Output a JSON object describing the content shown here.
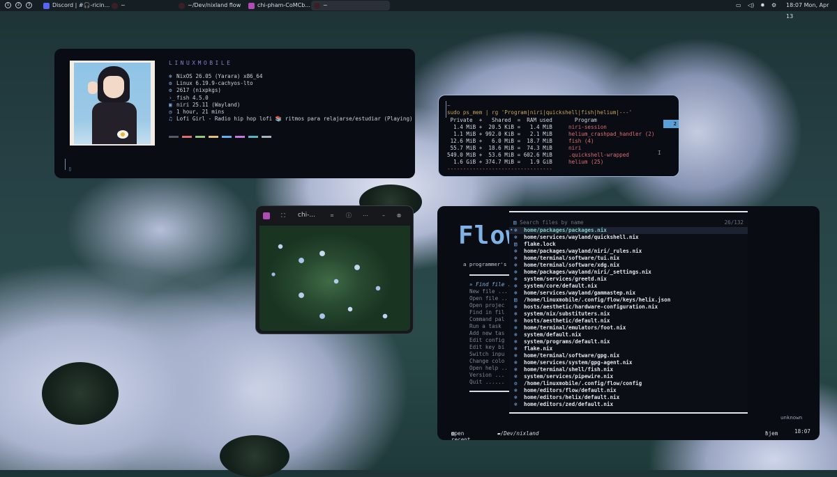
{
  "topbar": {
    "workspaces": [
      "1",
      "2",
      "3"
    ],
    "tasks": [
      {
        "label": "Discord | #🎧-ricin...",
        "color": "#5865f2"
      },
      {
        "label": "~",
        "color": "#3a1f24"
      },
      {
        "label": "~/Dev/nixland flow",
        "color": "#3a1f24"
      },
      {
        "label": "chi-pham-CoMCb...",
        "color": "#b04cb6"
      },
      {
        "label": "~",
        "color": "#3a1f24"
      }
    ],
    "clock": "18:07 Mon, Apr 13",
    "tray_icons": [
      "camera-icon",
      "volume-icon",
      "brightness-icon",
      "settings-icon"
    ]
  },
  "fetch": {
    "title": "LINUXMOBILE",
    "rows": [
      {
        "icon": "❄",
        "text": "NixOS 26.05 (Yarara) x86_64"
      },
      {
        "icon": "⚙",
        "text": "Linux 6.19.9-cachyos-lto"
      },
      {
        "icon": "⚙",
        "text": "2617 (nixpkgs)"
      },
      {
        "icon": "›_",
        "text": "fish 4.5.0"
      },
      {
        "icon": "▣",
        "text": "niri 25.11 (Wayland)"
      },
      {
        "icon": "◷",
        "text": "1 hour, 21 mins"
      },
      {
        "icon": "♫",
        "text": "Lofi Girl - Radio hip hop lofi 📚 ritmos para relajarse/estudiar (Playing)"
      }
    ],
    "swatches": [
      "#555a66",
      "#e06c75",
      "#98c379",
      "#e5c07b",
      "#61afef",
      "#c678dd",
      "#56b6c2",
      "#abb2bf"
    ],
    "cursor": "▯"
  },
  "psmem": {
    "tilde": "~",
    "command": "sudo ps_mem | rg 'Program|niri|quickshell|fish|helium|---'",
    "header": " Private  +   Shared  =  RAM used       Program",
    "rows": [
      {
        "mem": "  1.4 MiB +  20.5 KiB =   1.4 MiB",
        "prog": "niri-session",
        "color": "#e06c75"
      },
      {
        "mem": "  1.1 MiB + 992.0 KiB =   2.1 MiB",
        "prog": "helium_crashpad_handler (2)",
        "color": "#e06c75"
      },
      {
        "mem": " 12.6 MiB +   6.0 MiB =  18.7 MiB",
        "prog": "fish (4)",
        "color": "#e06c75"
      },
      {
        "mem": " 55.7 MiB +  18.6 MiB =  74.3 MiB",
        "prog": "niri",
        "color": "#e06c75"
      },
      {
        "mem": "549.0 MiB +  53.6 MiB = 602.6 MiB",
        "prog": ".quickshell-wrapped",
        "color": "#e06c75"
      },
      {
        "mem": "  1.6 GiB + 374.7 MiB =   1.9 GiB",
        "prog": "helium (25)",
        "color": "#e06c75"
      }
    ],
    "divider": "---------------------------------",
    "badge": "2"
  },
  "viewer": {
    "title": "chi-...",
    "icons": [
      "app-icon",
      "fullscreen-icon",
      "crop-icon",
      "info-icon",
      "more-icon",
      "minimize-icon",
      "close-icon"
    ]
  },
  "flow": {
    "banner": "Flow",
    "tagline": "a programmer's",
    "menu": [
      "» Find file ..",
      "  New file ...",
      "  Open file ..",
      "  Open projec",
      "  Find in fil",
      "  Command pal",
      "  Run a task",
      "  Add new tas",
      "  Edit config",
      "  Edit key bi",
      "  Switch inpu",
      "  Change colo",
      "  Open help ..",
      "  Version ...",
      "  Quit ......"
    ],
    "search_placeholder": "Search files by name",
    "count": "26/132",
    "files": [
      {
        "path": "home/packages/packages.nix",
        "icon": "❄",
        "current": true
      },
      {
        "path": "home/services/wayland/quickshell.nix",
        "icon": "❄"
      },
      {
        "path": "flake.lock",
        "icon": "▤"
      },
      {
        "path": "home/packages/wayland/niri/_rules.nix",
        "icon": "❄"
      },
      {
        "path": "home/terminal/software/tui.nix",
        "icon": "❄"
      },
      {
        "path": "home/terminal/software/xdg.nix",
        "icon": "❄"
      },
      {
        "path": "home/packages/wayland/niri/_settings.nix",
        "icon": "❄"
      },
      {
        "path": "system/services/greetd.nix",
        "icon": "❄"
      },
      {
        "path": "system/core/default.nix",
        "icon": "❄"
      },
      {
        "path": "home/services/wayland/gammastep.nix",
        "icon": "❄"
      },
      {
        "path": "/home/linuxmobile/.config/flow/keys/helix.json",
        "icon": "▤"
      },
      {
        "path": "hosts/aesthetic/hardware-configuration.nix",
        "icon": "❄"
      },
      {
        "path": "system/nix/substituters.nix",
        "icon": "❄"
      },
      {
        "path": "hosts/aesthetic/default.nix",
        "icon": "❄"
      },
      {
        "path": "home/terminal/emulators/foot.nix",
        "icon": "❄"
      },
      {
        "path": "system/default.nix",
        "icon": "❄"
      },
      {
        "path": "system/programs/default.nix",
        "icon": "❄"
      },
      {
        "path": "flake.nix",
        "icon": "❄"
      },
      {
        "path": "home/terminal/software/gpg.nix",
        "icon": "❄"
      },
      {
        "path": "home/services/system/gpg-agent.nix",
        "icon": "❄"
      },
      {
        "path": "home/terminal/shell/fish.nix",
        "icon": "❄"
      },
      {
        "path": "system/services/pipewire.nix",
        "icon": "❄"
      },
      {
        "path": "/home/linuxmobile/.config/flow/config",
        "icon": "⚙"
      },
      {
        "path": "home/editors/flow/default.nix",
        "icon": "❄"
      },
      {
        "path": "home/editors/helix/default.nix",
        "icon": "❄"
      },
      {
        "path": "home/editors/zed/default.nix",
        "icon": "❄"
      }
    ],
    "unknown": "unknown",
    "status_left": "open recent",
    "status_path": "~/Dev/nixland",
    "status_branch": "hjem",
    "status_time": "18:07"
  }
}
